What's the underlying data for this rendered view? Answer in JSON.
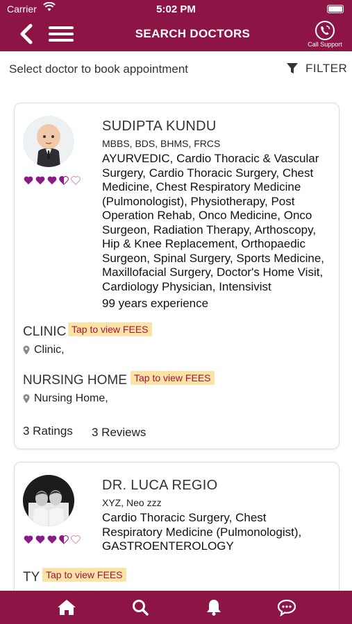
{
  "status_bar": {
    "carrier": "Carrier",
    "time": "5:02 PM"
  },
  "header": {
    "title": "SEARCH DOCTORS",
    "call_support_label": "Call Support"
  },
  "subheader": {
    "text": "Select doctor to book appointment",
    "filter_label": "FILTER"
  },
  "doctors": [
    {
      "name": "SUDIPTA KUNDU",
      "qualifications": "MBBS, BDS, BHMS, FRCS",
      "specialities": [
        "AYURVEDIC, Cardio Thoracic & Vascular",
        "Surgery, Cardio Thoracic Surgery, Chest",
        "Medicine, Chest Respiratory Medicine",
        "(Pulmonologist), Physiotherapy, Post",
        "Operation Rehab, Onco Medicine, Onco",
        "Surgeon, Radiation Therapy, Arthoscopy,",
        "Hip & Knee Replacement, Orthopaedic",
        "Surgeon, Spinal Surgery, Sports Medicine,",
        "Maxillofacial Surgery, Doctor's Home Visit,",
        "Cardiology Physician, Intensivist"
      ],
      "experience": "99 years experience",
      "rating": 3.5,
      "clinic_title": "CLINIC",
      "clinic_fees": "Tap to view FEES",
      "clinic_location": "Clinic,",
      "nursing_title": "NURSING HOME",
      "nursing_fees": "Tap to view FEES",
      "nursing_location": "Nursing Home,",
      "ratings": "3 Ratings",
      "reviews": "3 Reviews"
    },
    {
      "name": "DR.  LUCA REGIO",
      "qualifications": "XYZ, Neo zzz",
      "specialities": [
        "Cardio Thoracic Surgery, Chest",
        "Respiratory Medicine (Pulmonologist),",
        "GASTROENTEROLOGY"
      ],
      "rating": 3.5,
      "clinic_title": "TY",
      "clinic_fees": "Tap to view FEES"
    }
  ],
  "bottom_tabs": [
    "home-icon",
    "search-icon",
    "bell-icon",
    "chat-icon"
  ],
  "colors": {
    "brand": "#8c1545",
    "heart": "#8b1a89",
    "fees_bg": "#fbe3a5",
    "fees_text": "#a3123f"
  }
}
